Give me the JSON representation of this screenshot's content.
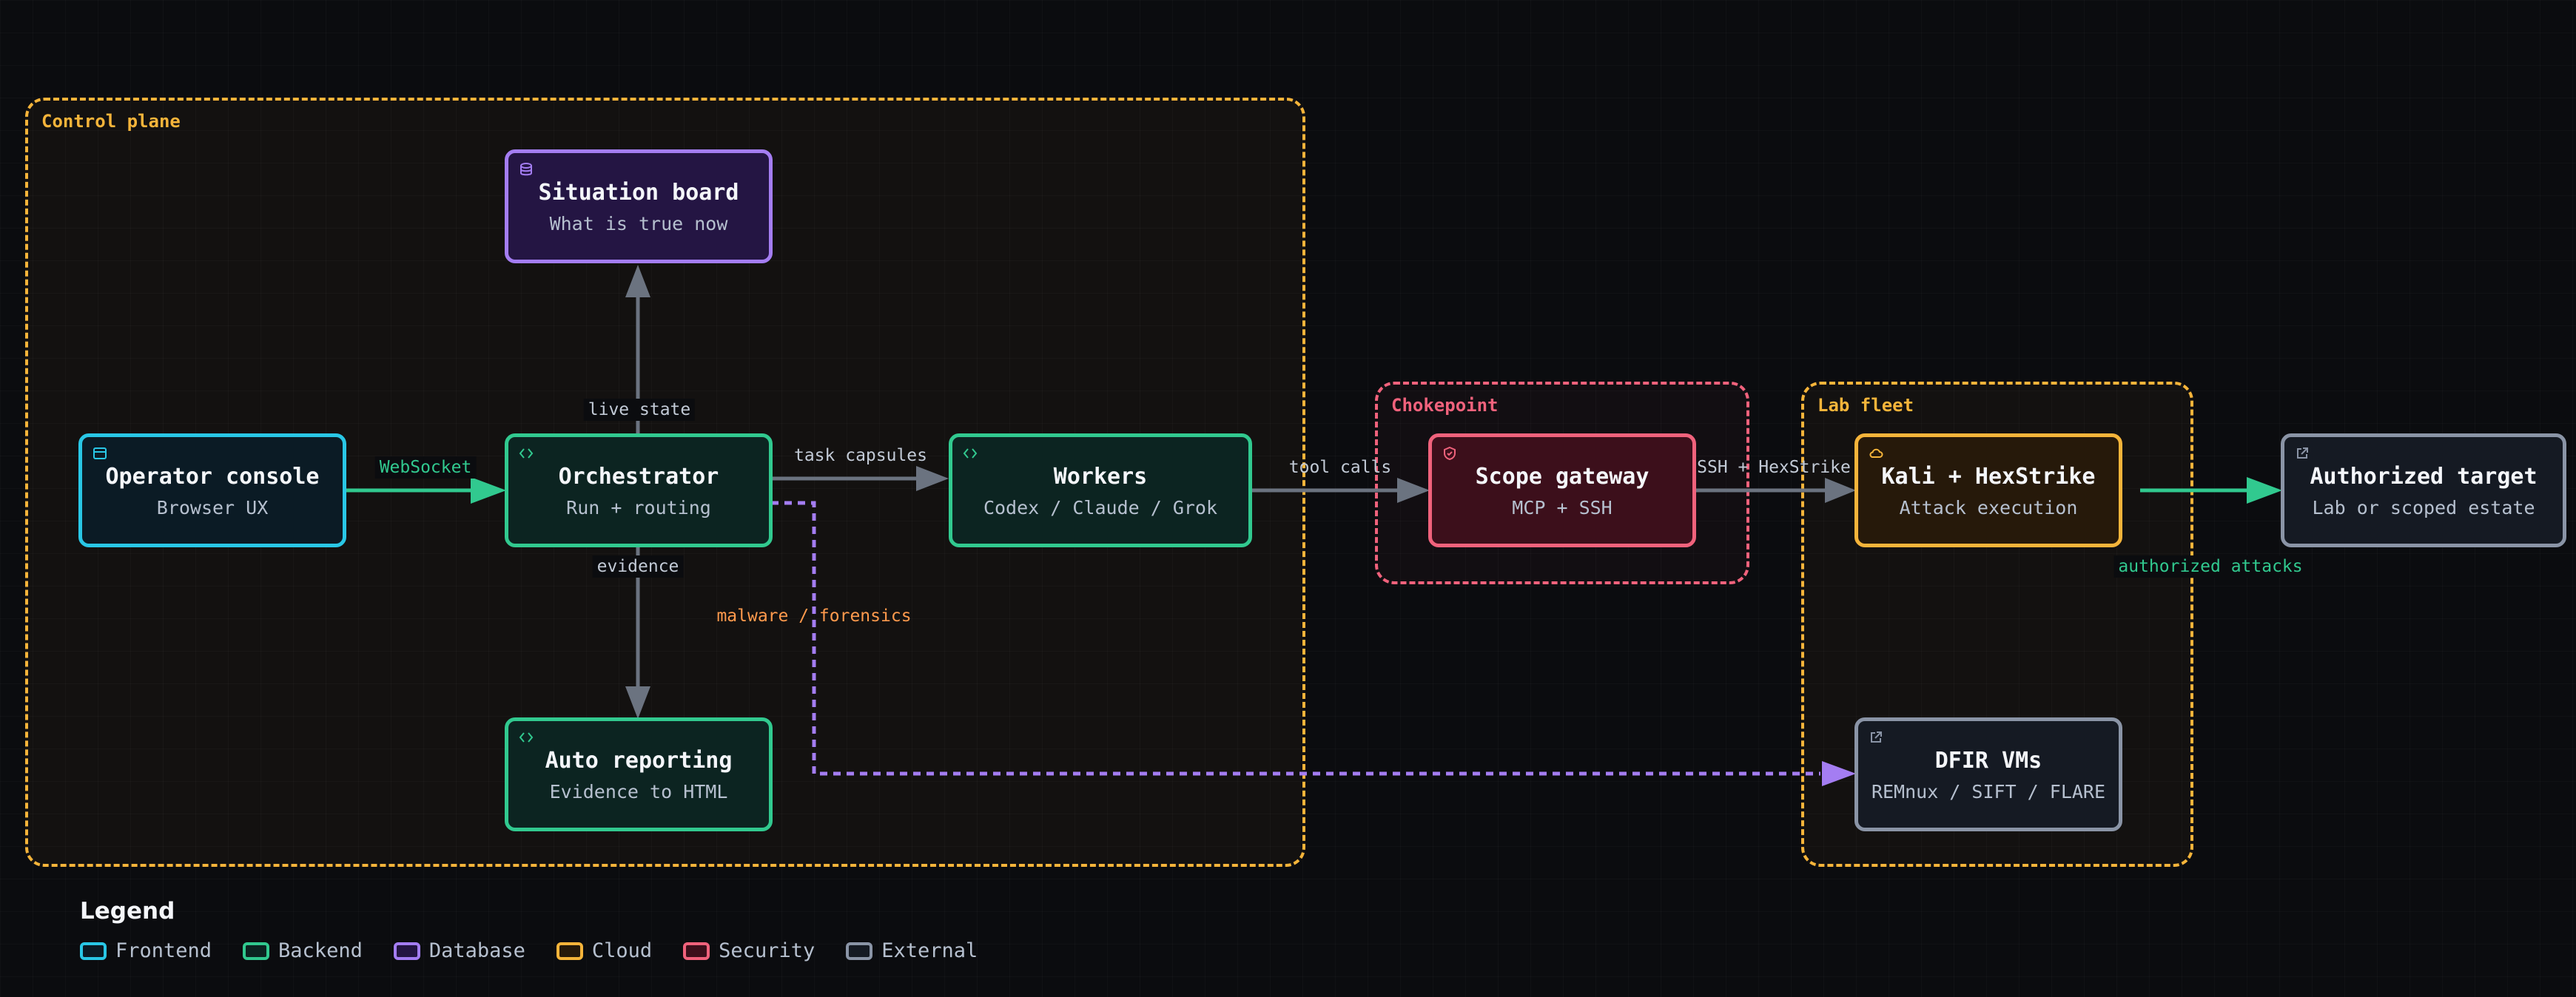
{
  "groups": {
    "control_plane": "Control plane",
    "chokepoint": "Chokepoint",
    "lab_fleet": "Lab fleet"
  },
  "nodes": {
    "operator_console": {
      "title": "Operator console",
      "sub": "Browser UX",
      "category": "Frontend",
      "icon": "browser-window-icon"
    },
    "orchestrator": {
      "title": "Orchestrator",
      "sub": "Run + routing",
      "category": "Backend",
      "icon": "code-brackets-icon"
    },
    "situation_board": {
      "title": "Situation board",
      "sub": "What is true now",
      "category": "Database",
      "icon": "database-icon"
    },
    "workers": {
      "title": "Workers",
      "sub": "Codex / Claude / Grok",
      "category": "Backend",
      "icon": "code-brackets-icon"
    },
    "auto_reporting": {
      "title": "Auto reporting",
      "sub": "Evidence to HTML",
      "category": "Backend",
      "icon": "code-brackets-icon"
    },
    "scope_gateway": {
      "title": "Scope gateway",
      "sub": "MCP + SSH",
      "category": "Security",
      "icon": "shield-icon"
    },
    "kali_hexstrike": {
      "title": "Kali + HexStrike",
      "sub": "Attack execution",
      "category": "Cloud",
      "icon": "cloud-icon"
    },
    "authorized_target": {
      "title": "Authorized target",
      "sub": "Lab or scoped estate",
      "category": "External",
      "icon": "external-link-icon"
    },
    "dfir_vms": {
      "title": "DFIR VMs",
      "sub": "REMnux / SIFT / FLARE",
      "category": "External",
      "icon": "external-link-icon"
    }
  },
  "edges": {
    "websocket": "WebSocket",
    "live_state": "live state",
    "task_capsules": "task capsules",
    "evidence": "evidence",
    "malware_forensics": "malware / forensics",
    "tool_calls": "tool calls",
    "ssh_hexstrike": "SSH + HexStrike",
    "authorized_attacks": "authorized attacks"
  },
  "legend": {
    "title": "Legend",
    "items": [
      {
        "label": "Frontend",
        "color": "#29c7e6"
      },
      {
        "label": "Backend",
        "color": "#31c98f"
      },
      {
        "label": "Database",
        "color": "#a47df2"
      },
      {
        "label": "Cloud",
        "color": "#f5b43a"
      },
      {
        "label": "Security",
        "color": "#f0627c"
      },
      {
        "label": "External",
        "color": "#8a94a6"
      }
    ]
  },
  "colors": {
    "background": "#0b0c0f",
    "frontend": "#29c7e6",
    "backend": "#31c98f",
    "database": "#a47df2",
    "cloud": "#f5b43a",
    "security": "#f0627c",
    "external": "#8a94a6",
    "edge_default": "#6b7380",
    "edge_malware": "#a47df2",
    "label_malware": "#ff9a4d"
  }
}
